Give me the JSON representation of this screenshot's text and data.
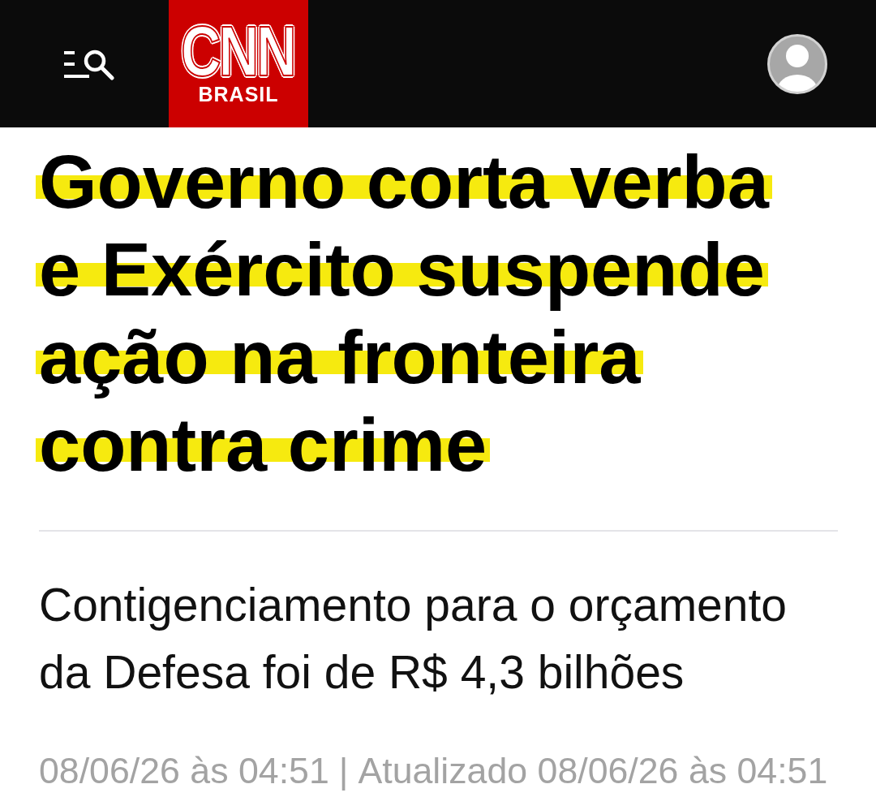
{
  "header": {
    "logo": {
      "wordmark": "CNN",
      "edition": "BRASIL"
    }
  },
  "article": {
    "headline": "Governo corta verba e Exército suspende ação na fronteira contra crime",
    "subheadline": "Contigenciamento para o orçamento da Defesa foi de R$ 4,3 bilhões",
    "published": "08/06/26 às 04:51",
    "separator": "|",
    "updated": "Atualizado 08/06/26 às 04:51"
  }
}
